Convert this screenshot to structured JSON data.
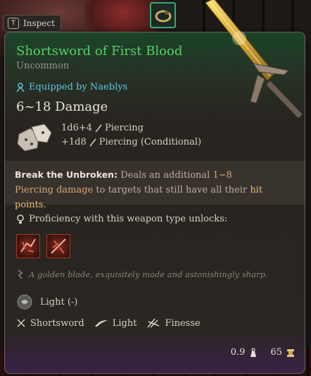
{
  "inspect": {
    "key": "T",
    "label": "Inspect"
  },
  "item": {
    "name": "Shortsword of First Blood",
    "rarity": "Uncommon",
    "equipped_by": "Equipped by Naeblys",
    "damage_total": "6~18 Damage",
    "damage_lines": [
      {
        "dice": "1d6+4",
        "type": "Piercing"
      },
      {
        "dice": "+1d8",
        "type": "Piercing (Conditional)"
      }
    ],
    "passive": {
      "name": "Break the Unbroken:",
      "text1": " Deals an additional ",
      "hl1": "1~8 Piercing",
      "hl1b": "damage",
      "text2": " to targets that still have all their ",
      "hl2": "hit points",
      "text3": "."
    },
    "proficiency_text": "Proficiency with this weapon type unlocks:",
    "flavor": "A golden blade, exquisitely made and astonishingly sharp.",
    "light": "Light (-)",
    "properties": [
      "Shortsword",
      "Light",
      "Finesse"
    ],
    "weight": "0.9",
    "value": "65"
  },
  "colors": {
    "title": "#58d068",
    "equipped": "#5cc8e0",
    "highlight": "#d8a878"
  },
  "icons": [
    "inspect-key-icon",
    "equipped-icon",
    "dice-icon",
    "piercing-icon",
    "proficiency-icon",
    "flavor-icon",
    "light-icon",
    "shortsword-icon",
    "light-weapon-icon",
    "finesse-icon",
    "weight-icon",
    "gold-icon"
  ]
}
